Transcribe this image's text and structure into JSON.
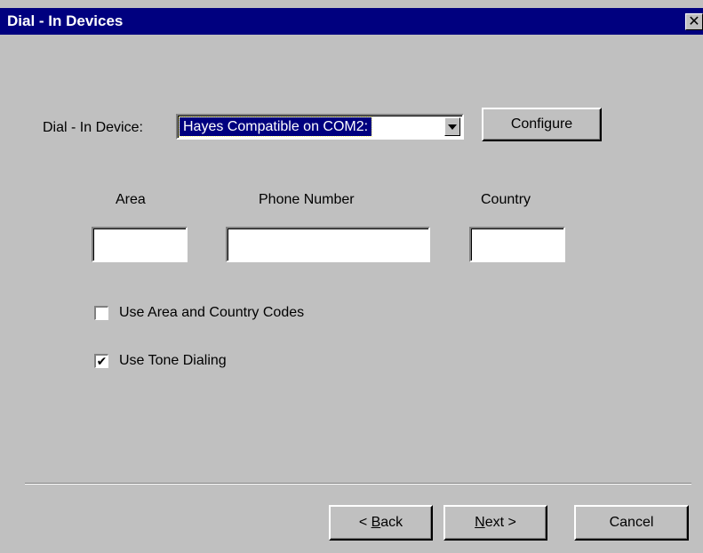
{
  "window": {
    "title": "Dial - In Devices",
    "close_glyph": "✕"
  },
  "device": {
    "label": "Dial - In Device:",
    "selected": "Hayes Compatible on COM2:",
    "configure_label": "Configure"
  },
  "fields": {
    "area_label": "Area",
    "area_value": "",
    "phone_label": "Phone Number",
    "phone_value": "",
    "country_label": "Country",
    "country_value": ""
  },
  "options": {
    "use_codes": {
      "label": "Use Area and Country Codes",
      "checked": false
    },
    "use_tone": {
      "label": "Use Tone Dialing",
      "checked": true
    }
  },
  "buttons": {
    "back": {
      "prefix": "< ",
      "mnemonic": "B",
      "rest": "ack"
    },
    "next": {
      "mnemonic": "N",
      "rest": "ext >"
    },
    "cancel": "Cancel"
  }
}
